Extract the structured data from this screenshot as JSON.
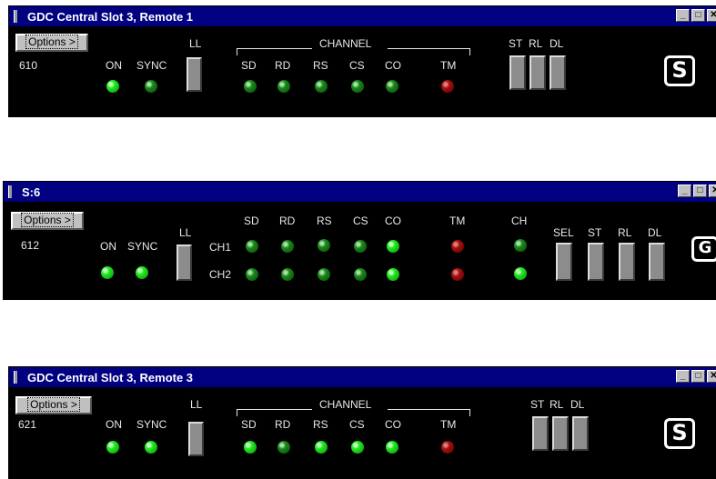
{
  "windows": [
    {
      "title": "GDC Central Slot 3, Remote 1",
      "options_label": "Options >",
      "id_number": "610",
      "labels": {
        "on": "ON",
        "sync": "SYNC",
        "ll": "LL",
        "channel": "CHANNEL",
        "sd": "SD",
        "rd": "RD",
        "rs": "RS",
        "cs": "CS",
        "co": "CO",
        "tm": "TM",
        "st": "ST",
        "rl": "RL",
        "dl": "DL"
      },
      "led_states": {
        "on": "green-bright",
        "sync": "green-dark",
        "sd": "green-dark",
        "rd": "green-dark",
        "rs": "green-dark",
        "cs": "green-dark",
        "co": "green-dark",
        "tm": "red"
      }
    },
    {
      "title": "S:6",
      "options_label": "Options >",
      "id_number": "612",
      "labels": {
        "on": "ON",
        "sync": "SYNC",
        "ll": "LL",
        "sd": "SD",
        "rd": "RD",
        "rs": "RS",
        "cs": "CS",
        "co": "CO",
        "tm": "TM",
        "ch": "CH",
        "ch1": "CH1",
        "ch2": "CH2",
        "sel": "SEL",
        "st": "ST",
        "rl": "RL",
        "dl": "DL"
      },
      "led_states": {
        "on": "green-bright",
        "sync": "green-bright",
        "ch1": [
          "green-dark",
          "green-dark",
          "green-dark",
          "green-dark",
          "green-bright"
        ],
        "ch2": [
          "green-dark",
          "green-dark",
          "green-dark",
          "green-dark",
          "green-bright"
        ],
        "tm": [
          "red",
          "red"
        ],
        "ch": [
          "green-dark",
          "green-bright"
        ]
      }
    },
    {
      "title": "GDC Central Slot 3, Remote 3",
      "options_label": "Options >",
      "id_number": "621",
      "labels": {
        "on": "ON",
        "sync": "SYNC",
        "ll": "LL",
        "channel": "CHANNEL",
        "sd": "SD",
        "rd": "RD",
        "rs": "RS",
        "cs": "CS",
        "co": "CO",
        "tm": "TM",
        "st": "ST",
        "rl": "RL",
        "dl": "DL"
      },
      "led_states": {
        "on": "green-bright",
        "sync": "green-bright",
        "sd": "green-bright",
        "rd": "green-dark",
        "rs": "green-bright",
        "cs": "green-bright",
        "co": "green-bright",
        "tm": "red"
      }
    }
  ],
  "window_controls": {
    "minimize": "_",
    "maximize": "□",
    "close": "✕"
  },
  "logo_icons": [
    "gdc-logo-icon",
    "gdc-logo-icon",
    "gdc-logo-icon"
  ]
}
